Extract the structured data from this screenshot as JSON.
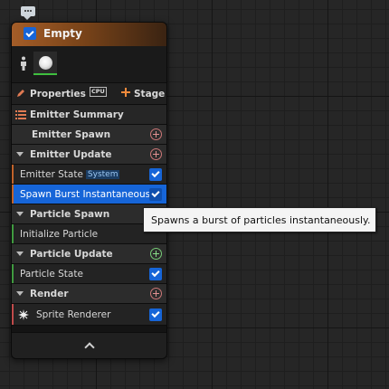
{
  "node": {
    "title": "Empty",
    "properties_label": "Properties",
    "cpu_badge": "CPU",
    "stage_label": "Stage",
    "emitter_summary_label": "Emitter Summary",
    "sections": [
      {
        "label": "Emitter Spawn"
      },
      {
        "label": "Emitter Update"
      },
      {
        "label": "Particle Spawn"
      },
      {
        "label": "Particle Update"
      },
      {
        "label": "Render"
      }
    ],
    "modules": [
      {
        "label": "Emitter State",
        "badge": "System"
      },
      {
        "label": "Spawn Burst Instantaneous"
      },
      {
        "label": "Initialize Particle"
      },
      {
        "label": "Particle State"
      },
      {
        "label": "Sprite Renderer"
      }
    ]
  },
  "tooltip": {
    "text": "Spawns a burst of particles instantaneously."
  },
  "colors": {
    "header_start": "#a45d28",
    "selection": "#1665d8",
    "emitter_stripe": "#c0622a",
    "particle_stripe": "#3f9a3f",
    "render_stripe": "#c04a4a"
  },
  "icons": [
    "comment-icon",
    "checkbox-icon",
    "person-icon",
    "sprite-thumbnail-icon",
    "pencil-icon",
    "cpu-icon",
    "plus-icon",
    "add-circle-icon",
    "collapse-arrow-icon",
    "sprite-renderer-icon",
    "chevron-up-icon"
  ]
}
